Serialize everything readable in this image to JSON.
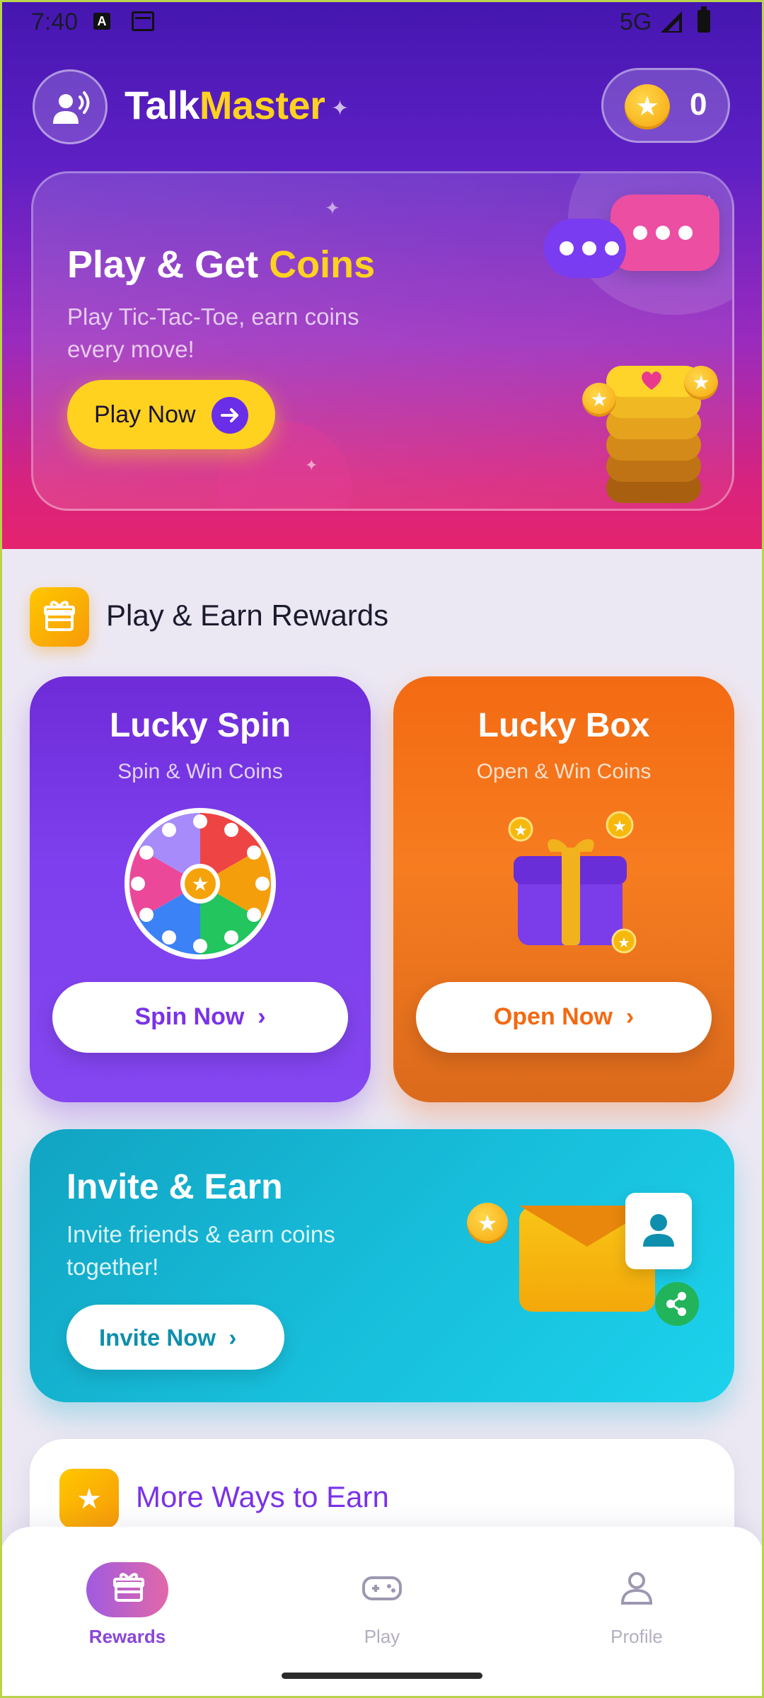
{
  "status_bar": {
    "time": "7:40",
    "network": "5G"
  },
  "header": {
    "brand_part1": "Talk",
    "brand_part2": "Master",
    "coin_count": "0"
  },
  "promo": {
    "title_part1": "Play & Get ",
    "title_part2": "Coins",
    "subtitle": "Play Tic-Tac-Toe, earn coins every move!",
    "button_label": "Play Now"
  },
  "rewards_section": {
    "title": "Play & Earn Rewards"
  },
  "lucky_spin": {
    "title": "Lucky Spin",
    "subtitle": "Spin & Win Coins",
    "button_label": "Spin Now"
  },
  "lucky_box": {
    "title": "Lucky Box",
    "subtitle": "Open & Win Coins",
    "button_label": "Open Now"
  },
  "invite": {
    "title": "Invite & Earn",
    "subtitle": "Invite friends & earn coins together!",
    "button_label": "Invite Now"
  },
  "more_ways": {
    "title": "More Ways to Earn"
  },
  "bottom_nav": {
    "items": [
      {
        "label": "Rewards"
      },
      {
        "label": "Play"
      },
      {
        "label": "Profile"
      }
    ]
  },
  "colors": {
    "brand_yellow": "#FFD21F",
    "primary_purple": "#7A32E8",
    "box_orange": "#F77C20",
    "invite_cyan": "#17BDDA",
    "nav_inactive": "#9E97B0"
  },
  "icons": {
    "logo": "speaking-person-icon",
    "coin": "star-coin-icon",
    "section": "gift-icon",
    "share": "share-icon",
    "user": "user-icon"
  }
}
